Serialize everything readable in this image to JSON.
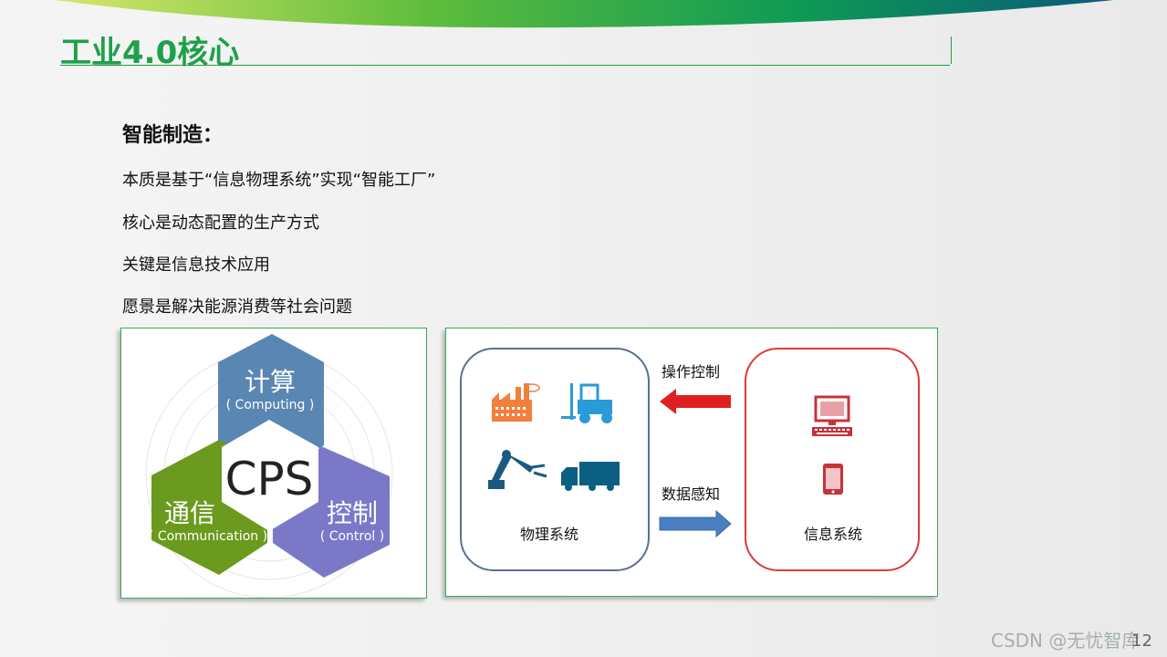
{
  "slide": {
    "title": "工业4.0核心",
    "heading": "智能制造：",
    "bullets": [
      "本质是基于“信息物理系统”实现“智能工厂”",
      "核心是动态配置的生产方式",
      "关键是信息技术应用",
      "愿景是解决能源消费等社会问题"
    ],
    "page_number": "12",
    "watermark": "CSDN @无忧智库"
  },
  "cps_diagram": {
    "center": "CPS",
    "computing": {
      "title": "计算",
      "subtitle": "( Computing )",
      "color": "#5a86b3"
    },
    "communication": {
      "title": "通信",
      "subtitle": "( Communication )",
      "color": "#6b9a1e"
    },
    "control": {
      "title": "控制",
      "subtitle": "( Control )",
      "color": "#7b78c8"
    }
  },
  "system_diagram": {
    "physical_label": "物理系统",
    "info_label": "信息系统",
    "operate_label": "操作控制",
    "sense_label": "数据感知",
    "physical_icons": [
      "factory-icon",
      "forklift-icon",
      "robot-arm-icon",
      "truck-icon"
    ],
    "info_icons": [
      "computer-icon",
      "smartphone-icon"
    ],
    "colors": {
      "physical_border": "#5a7090",
      "info_border": "#e0383a",
      "red_arrow": "#e02020",
      "blue_arrow": "#4a7ec0"
    }
  }
}
